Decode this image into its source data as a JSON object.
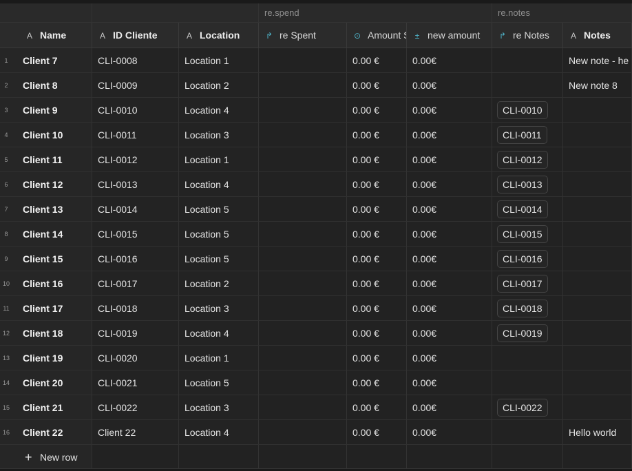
{
  "groups": {
    "spend": "re.spend",
    "notes": "re.notes"
  },
  "columns": {
    "name": "Name",
    "id_cliente": "ID Cliente",
    "location": "Location",
    "re_spent": "re Spent",
    "amount": "Amount S",
    "new_amount": "new amount",
    "re_notes": "re Notes",
    "notes": "Notes"
  },
  "rows": [
    {
      "num": "1",
      "name": "Client 7",
      "id": "CLI-0008",
      "location": "Location 1",
      "amount": "0.00 €",
      "new_amount": "0.00€",
      "re_notes": "",
      "notes": "New note - he"
    },
    {
      "num": "2",
      "name": "Client 8",
      "id": "CLI-0009",
      "location": "Location 2",
      "amount": "0.00 €",
      "new_amount": "0.00€",
      "re_notes": "",
      "notes": "New note 8"
    },
    {
      "num": "3",
      "name": "Client 9",
      "id": "CLI-0010",
      "location": "Location 4",
      "amount": "0.00 €",
      "new_amount": "0.00€",
      "re_notes": "CLI-0010",
      "notes": ""
    },
    {
      "num": "4",
      "name": "Client 10",
      "id": "CLI-0011",
      "location": "Location 3",
      "amount": "0.00 €",
      "new_amount": "0.00€",
      "re_notes": "CLI-0011",
      "notes": ""
    },
    {
      "num": "5",
      "name": "Client 11",
      "id": "CLI-0012",
      "location": "Location 1",
      "amount": "0.00 €",
      "new_amount": "0.00€",
      "re_notes": "CLI-0012",
      "notes": ""
    },
    {
      "num": "6",
      "name": "Client 12",
      "id": "CLI-0013",
      "location": "Location 4",
      "amount": "0.00 €",
      "new_amount": "0.00€",
      "re_notes": "CLI-0013",
      "notes": ""
    },
    {
      "num": "7",
      "name": "Client 13",
      "id": "CLI-0014",
      "location": "Location 5",
      "amount": "0.00 €",
      "new_amount": "0.00€",
      "re_notes": "CLI-0014",
      "notes": ""
    },
    {
      "num": "8",
      "name": "Client 14",
      "id": "CLI-0015",
      "location": "Location 5",
      "amount": "0.00 €",
      "new_amount": "0.00€",
      "re_notes": "CLI-0015",
      "notes": ""
    },
    {
      "num": "9",
      "name": "Client 15",
      "id": "CLI-0016",
      "location": "Location 5",
      "amount": "0.00 €",
      "new_amount": "0.00€",
      "re_notes": "CLI-0016",
      "notes": ""
    },
    {
      "num": "10",
      "name": "Client 16",
      "id": "CLI-0017",
      "location": "Location 2",
      "amount": "0.00 €",
      "new_amount": "0.00€",
      "re_notes": "CLI-0017",
      "notes": ""
    },
    {
      "num": "11",
      "name": "Client 17",
      "id": "CLI-0018",
      "location": "Location 3",
      "amount": "0.00 €",
      "new_amount": "0.00€",
      "re_notes": "CLI-0018",
      "notes": ""
    },
    {
      "num": "12",
      "name": "Client 18",
      "id": "CLI-0019",
      "location": "Location 4",
      "amount": "0.00 €",
      "new_amount": "0.00€",
      "re_notes": "CLI-0019",
      "notes": ""
    },
    {
      "num": "13",
      "name": "Client 19",
      "id": "CLI-0020",
      "location": "Location 1",
      "amount": "0.00 €",
      "new_amount": "0.00€",
      "re_notes": "",
      "notes": ""
    },
    {
      "num": "14",
      "name": "Client 20",
      "id": "CLI-0021",
      "location": "Location 5",
      "amount": "0.00 €",
      "new_amount": "0.00€",
      "re_notes": "",
      "notes": ""
    },
    {
      "num": "15",
      "name": "Client 21",
      "id": "CLI-0022",
      "location": "Location 3",
      "amount": "0.00 €",
      "new_amount": "0.00€",
      "re_notes": "CLI-0022",
      "notes": ""
    },
    {
      "num": "16",
      "name": "Client 22",
      "id": "Client 22",
      "location": "Location 4",
      "amount": "0.00 €",
      "new_amount": "0.00€",
      "re_notes": "",
      "notes": "Hello world"
    }
  ],
  "new_row_label": "New row",
  "icons": {
    "text": "text-type-icon",
    "lookup": "lookup-arrow-icon",
    "currency": "currency-icon",
    "formula": "formula-icon",
    "plus": "plus-icon"
  },
  "colors": {
    "accent": "#4fb3c8",
    "background": "#222222"
  }
}
